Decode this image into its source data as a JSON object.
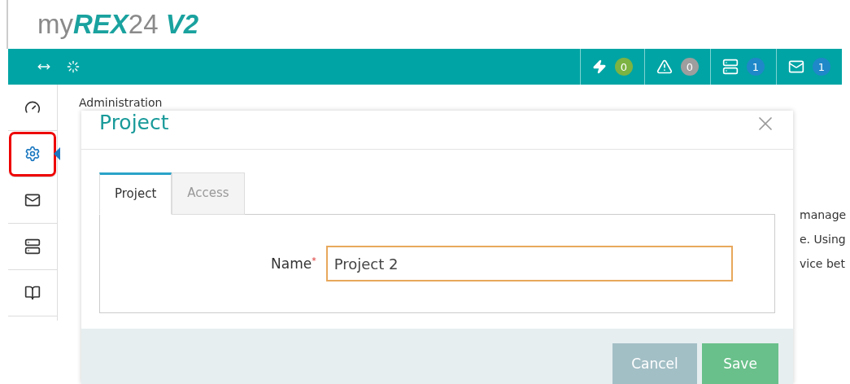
{
  "logo": {
    "prefix": "my",
    "brand": "REX",
    "suffix": "24",
    "version": "V2"
  },
  "topbar": {
    "indicators": [
      {
        "kind": "events",
        "count": "0",
        "color": "#7cb342"
      },
      {
        "kind": "alerts",
        "count": "0",
        "color": "#9e9e9e"
      },
      {
        "kind": "devices",
        "count": "1",
        "color": "#1e88c8"
      },
      {
        "kind": "messages",
        "count": "1",
        "color": "#1e88c8"
      }
    ]
  },
  "sidebar": {
    "items": [
      {
        "kind": "dashboard",
        "selected": false
      },
      {
        "kind": "settings",
        "selected": true
      },
      {
        "kind": "mail",
        "selected": false
      },
      {
        "kind": "devices",
        "selected": false
      },
      {
        "kind": "book",
        "selected": false
      }
    ]
  },
  "content": {
    "breadcrumb": "Administration",
    "fragments": [
      "manage",
      "e. Using",
      "vice bet"
    ]
  },
  "dialog": {
    "title": "Project",
    "tabs": [
      {
        "label": "Project",
        "selected": true
      },
      {
        "label": "Access",
        "selected": false
      }
    ],
    "field": {
      "label": "Name",
      "required_mark": "*",
      "value": "Project 2"
    },
    "buttons": [
      {
        "kind": "cancel",
        "label": "Cancel"
      },
      {
        "kind": "save",
        "label": "Save"
      }
    ]
  }
}
